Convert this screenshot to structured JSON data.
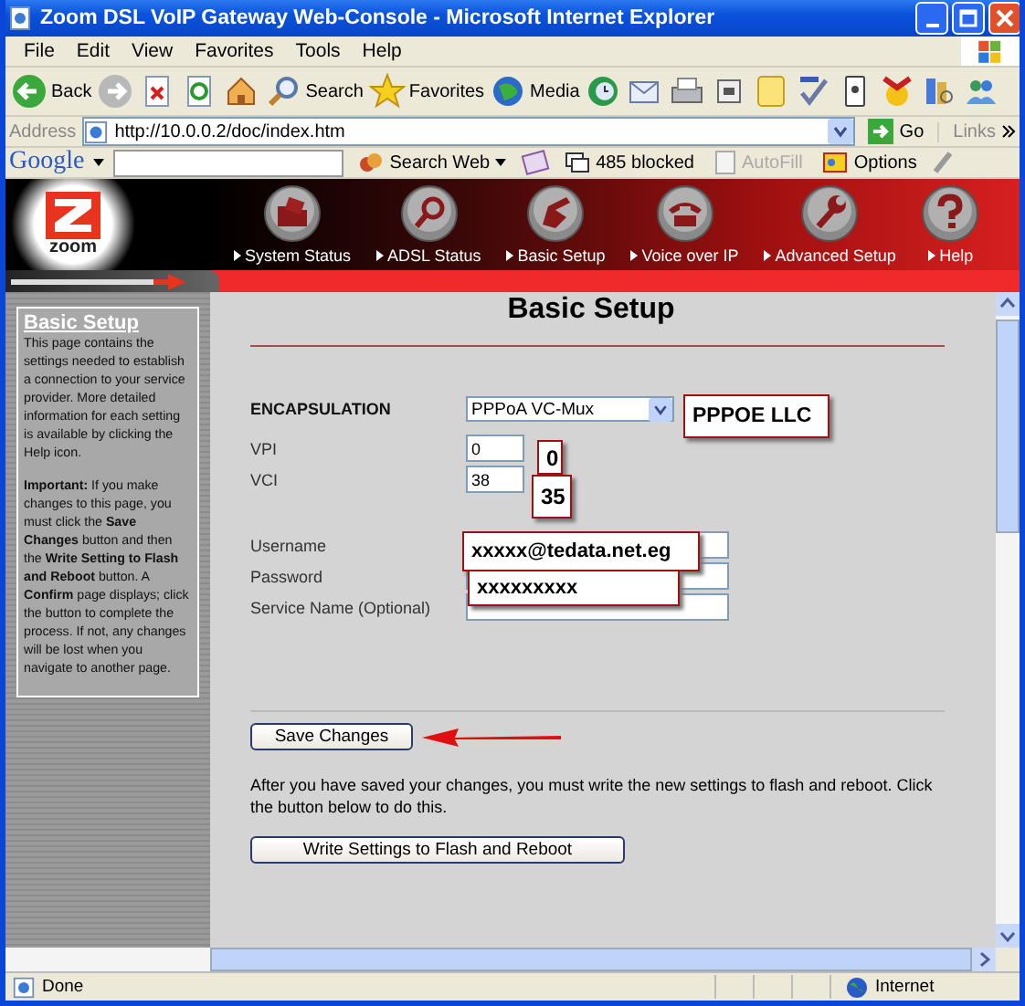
{
  "window": {
    "title": "Zoom DSL VoIP Gateway Web-Console - Microsoft Internet Explorer"
  },
  "menu": [
    "File",
    "Edit",
    "View",
    "Favorites",
    "Tools",
    "Help"
  ],
  "toolbar": [
    {
      "kind": "back",
      "label": "Back"
    },
    {
      "kind": "forward"
    },
    {
      "kind": "stop"
    },
    {
      "kind": "refresh"
    },
    {
      "kind": "home"
    },
    {
      "kind": "search",
      "label": "Search"
    },
    {
      "kind": "favorites",
      "label": "Favorites"
    },
    {
      "kind": "media",
      "label": "Media"
    },
    {
      "kind": "history"
    },
    {
      "kind": "mail"
    },
    {
      "kind": "print"
    },
    {
      "kind": "edit"
    },
    {
      "kind": "note"
    },
    {
      "kind": "spell"
    },
    {
      "kind": "device"
    },
    {
      "kind": "badge"
    },
    {
      "kind": "book"
    },
    {
      "kind": "people"
    }
  ],
  "address": {
    "label": "Address",
    "url": "http://10.0.0.2/doc/index.htm",
    "go": "Go",
    "links": "Links"
  },
  "google_bar": {
    "logo": "Google",
    "search_web": "Search Web",
    "blocked": "485 blocked",
    "autofill": {
      "label": "AutoFill",
      "disabled": true
    },
    "options": "Options"
  },
  "nav": {
    "logo": "zoom",
    "items": [
      {
        "kind": "folder",
        "label": "System Status"
      },
      {
        "kind": "magnifier",
        "label": "ADSL Status"
      },
      {
        "kind": "hand",
        "label": "Basic Setup"
      },
      {
        "kind": "phone",
        "label": "Voice over IP"
      },
      {
        "kind": "wrench",
        "label": "Advanced Setup"
      },
      {
        "kind": "question",
        "label": "Help"
      }
    ]
  },
  "sidebar": {
    "title": "Basic Setup",
    "paragraphs": [
      "This page contains the settings needed to establish a connection to your service provider. More detailed information for each setting is available by clicking the Help icon.",
      "**Important:** If you make changes to this page, you must click the **Save Changes** button and then the **Write Setting to Flash and Reboot** button. A **Confirm** page displays; click the button to complete the process. If not, any changes will be lost when you navigate to another page."
    ]
  },
  "form": {
    "title": "Basic Setup",
    "encapsulation": {
      "label": "ENCAPSULATION",
      "value": "PPPoA VC-Mux"
    },
    "fields": [
      {
        "label": "VPI",
        "value": "0",
        "kind": "short"
      },
      {
        "label": "VCI",
        "value": "38",
        "kind": "short"
      },
      {
        "label": "Username",
        "kind": "long"
      },
      {
        "label": "Password",
        "kind": "long"
      },
      {
        "label": "Service Name (Optional)",
        "kind": "long"
      }
    ],
    "save_button": "Save Changes",
    "note": "After you have saved your changes, you must write the new settings to flash and reboot. Click the button below to do this.",
    "write_button": "Write Settings to Flash and Reboot"
  },
  "annotations": [
    {
      "text": "PPPOE LLC"
    },
    {
      "text": "0"
    },
    {
      "text": "35"
    },
    {
      "text": "xxxxx@tedata.net.eg"
    },
    {
      "text": "xxxxxxxxx"
    }
  ],
  "status_bar": {
    "text": "Done",
    "zone": "Internet"
  }
}
